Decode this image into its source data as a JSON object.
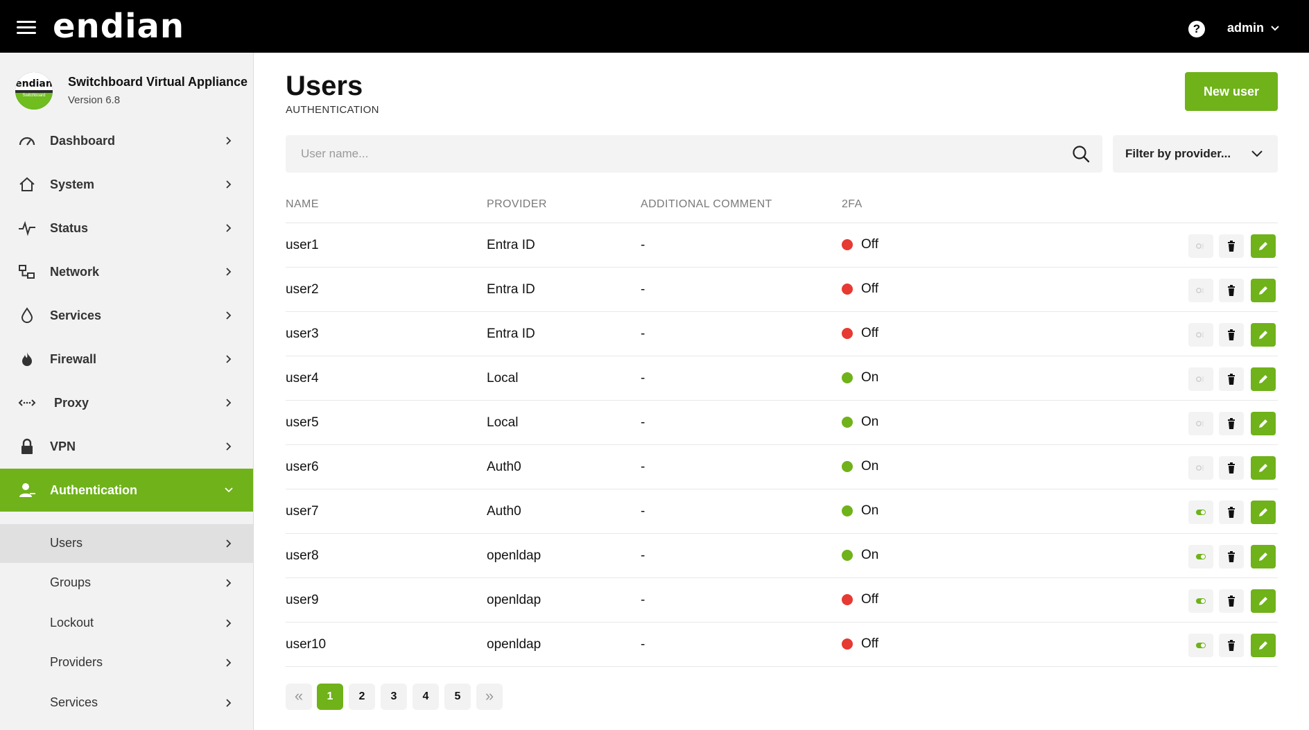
{
  "app": {
    "logo_text": "endian",
    "help_label": "?",
    "user_label": "admin"
  },
  "brand": {
    "badge_text": "endian",
    "badge_sub": "Switchboard",
    "title": "Switchboard Virtual Appliance",
    "version": "Version 6.8"
  },
  "nav": {
    "items": [
      {
        "label": "Dashboard",
        "icon": "gauge-icon"
      },
      {
        "label": "System",
        "icon": "home-icon"
      },
      {
        "label": "Status",
        "icon": "pulse-icon"
      },
      {
        "label": "Network",
        "icon": "network-icon"
      },
      {
        "label": "Services",
        "icon": "drop-icon"
      },
      {
        "label": "Firewall",
        "icon": "flame-icon"
      },
      {
        "label": "Proxy",
        "icon": "proxy-arrows-icon"
      },
      {
        "label": "VPN",
        "icon": "lock-icon"
      },
      {
        "label": "Authentication",
        "icon": "user-key-icon"
      }
    ],
    "sub_items": [
      {
        "label": "Users"
      },
      {
        "label": "Groups"
      },
      {
        "label": "Lockout"
      },
      {
        "label": "Providers"
      },
      {
        "label": "Services"
      }
    ]
  },
  "page": {
    "title": "Users",
    "subtitle": "AUTHENTICATION",
    "new_user_label": "New user"
  },
  "search": {
    "placeholder": "User name...",
    "value": ""
  },
  "filter": {
    "label": "Filter by provider..."
  },
  "table": {
    "headers": {
      "name": "NAME",
      "provider": "PROVIDER",
      "comment": "ADDITIONAL COMMENT",
      "twofa": "2FA"
    },
    "rows": [
      {
        "name": "user1",
        "provider": "Entra ID",
        "comment": "-",
        "twofa": "Off",
        "enabled": false
      },
      {
        "name": "user2",
        "provider": "Entra ID",
        "comment": "-",
        "twofa": "Off",
        "enabled": false
      },
      {
        "name": "user3",
        "provider": "Entra ID",
        "comment": "-",
        "twofa": "Off",
        "enabled": false
      },
      {
        "name": "user4",
        "provider": "Local",
        "comment": "-",
        "twofa": "On",
        "enabled": false
      },
      {
        "name": "user5",
        "provider": "Local",
        "comment": "-",
        "twofa": "On",
        "enabled": false
      },
      {
        "name": "user6",
        "provider": "Auth0",
        "comment": "-",
        "twofa": "On",
        "enabled": false
      },
      {
        "name": "user7",
        "provider": "Auth0",
        "comment": "-",
        "twofa": "On",
        "enabled": true
      },
      {
        "name": "user8",
        "provider": "openldap",
        "comment": "-",
        "twofa": "On",
        "enabled": true
      },
      {
        "name": "user9",
        "provider": "openldap",
        "comment": "-",
        "twofa": "Off",
        "enabled": true
      },
      {
        "name": "user10",
        "provider": "openldap",
        "comment": "-",
        "twofa": "Off",
        "enabled": true
      }
    ]
  },
  "pagination": {
    "pages": [
      "1",
      "2",
      "3",
      "4",
      "5"
    ],
    "current": "1",
    "prev_label": "«",
    "next_label": "»"
  },
  "colors": {
    "accent": "#6fb21a",
    "status_on": "#6fb21a",
    "status_off": "#e63a32"
  }
}
